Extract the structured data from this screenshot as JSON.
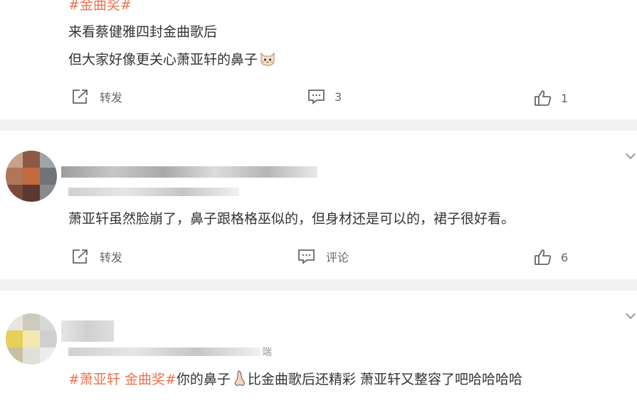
{
  "post1": {
    "hashtag": "#金曲奖#",
    "line1": "来看蔡健雅四封金曲歌后",
    "line2": "但大家好像更关心萧亚轩的鼻子",
    "emoji": "cat-face-emoji",
    "repost_label": "转发",
    "comment_count": "3",
    "like_count": "1"
  },
  "post2": {
    "text": "萧亚轩虽然脸崩了，鼻子跟格格巫似的，但身材还是可以的，裙子很好看。",
    "repost_label": "转发",
    "comment_label": "评论",
    "like_count": "6"
  },
  "post3": {
    "tag1": "#萧亚轩",
    "tag2": "金曲奖#",
    "text_a": "你的鼻子",
    "emoji": "nose-emoji",
    "text_b": "比金曲歌后还精彩 萧亚轩又整容了吧哈哈哈哈",
    "source_suffix": "端"
  },
  "colors": {
    "hashtag": "#eb7350",
    "text": "#333333",
    "action": "#666666",
    "divider": "#f2f2f5"
  },
  "icons": [
    "repost-icon",
    "comment-icon",
    "like-icon",
    "chevron-down-icon"
  ]
}
